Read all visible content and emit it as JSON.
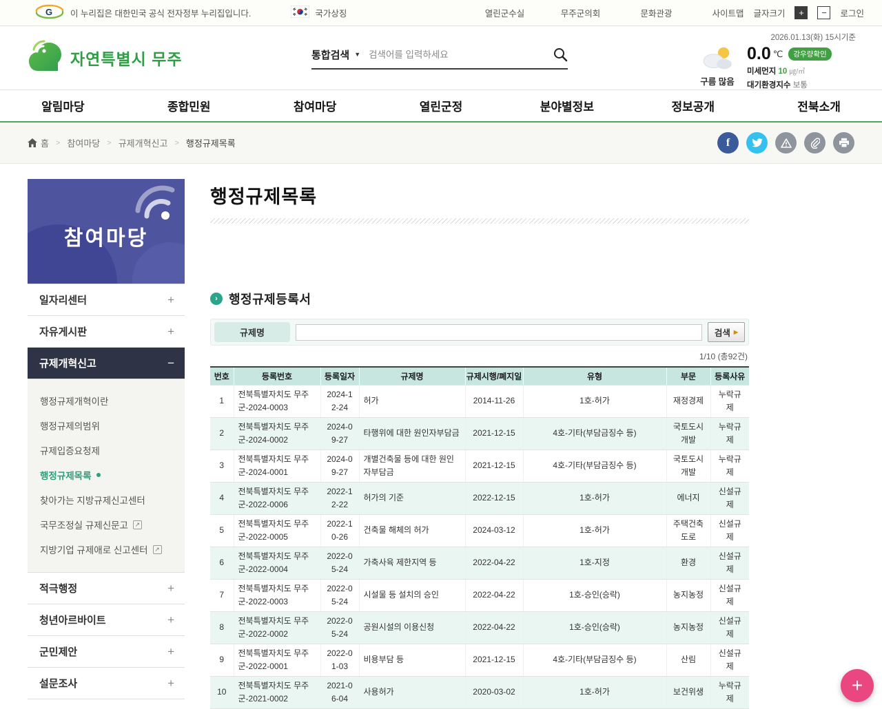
{
  "topbar": {
    "egov_notice": "이 누리집은 대한민국 공식 전자정부 누리집입니다.",
    "national_symbol": "국가상징",
    "links": [
      "열린군수실",
      "무주군의회",
      "문화관광"
    ],
    "sitemap": "사이트맵",
    "font_size_label": "글자크기",
    "font_plus": "+",
    "font_minus": "−",
    "login": "로그인"
  },
  "header": {
    "logo_text": "자연특별시 무주",
    "search": {
      "scope": "통합검색",
      "placeholder": "검색어를 입력하세요"
    },
    "weather": {
      "datetime": "2026.01.13(화) 15시기준",
      "condition": "구름 많음",
      "temperature": "0.0",
      "unit": "℃",
      "rain_badge": "강우량확인",
      "dust_label": "미세먼지",
      "dust_value": "10",
      "dust_unit": "㎍/㎥",
      "air_label": "대기환경지수",
      "air_value": "보통"
    }
  },
  "nav": {
    "items": [
      "알림마당",
      "종합민원",
      "참여마당",
      "열린군정",
      "분야별정보",
      "정보공개",
      "전북소개"
    ]
  },
  "breadcrumb": {
    "home": "홈",
    "items": [
      "참여마당",
      "규제개혁신고",
      "행정규제목록"
    ]
  },
  "sidebar": {
    "title": "참여마당",
    "menu": [
      {
        "label": "일자리센터",
        "toggle": "+"
      },
      {
        "label": "자유게시판",
        "toggle": "+"
      },
      {
        "label": "규제개혁신고",
        "toggle": "−"
      },
      {
        "label": "적극행정",
        "toggle": "+"
      },
      {
        "label": "청년아르바이트",
        "toggle": "+"
      },
      {
        "label": "군민제안",
        "toggle": "+"
      },
      {
        "label": "설문조사",
        "toggle": "+"
      }
    ],
    "submenu": [
      {
        "label": "행정규제개혁이란"
      },
      {
        "label": "행정규제의범위"
      },
      {
        "label": "규제입증요청제"
      },
      {
        "label": "행정규제목록"
      },
      {
        "label": "찾아가는 지방규제신고센터"
      },
      {
        "label": "국무조정실 규제신문고"
      },
      {
        "label": "지방기업 규제애로 신고센터"
      }
    ],
    "external_icon": "↗"
  },
  "main": {
    "page_title": "행정규제목록",
    "section_title": "행정규제등록서",
    "search_label": "규제명",
    "search_button": "검색",
    "count_info": "1/10 (총92건)",
    "table": {
      "headers": [
        "번호",
        "등록번호",
        "등록일자",
        "규제명",
        "규제시행/폐지일",
        "유형",
        "부문",
        "등록사유"
      ],
      "rows": [
        [
          "1",
          "전북특별자치도 무주군-2024-0003",
          "2024-12-24",
          "허가",
          "2014-11-26",
          "1호-허가",
          "재정경제",
          "누락규제"
        ],
        [
          "2",
          "전북특별자치도 무주군-2024-0002",
          "2024-09-27",
          "타행위에 대한 원인자부담금",
          "2021-12-15",
          "4호-기타(부담금징수 등)",
          "국토도시개발",
          "누락규제"
        ],
        [
          "3",
          "전북특별자치도 무주군-2024-0001",
          "2024-09-27",
          "개별건축물 등에 대한 원인자부담금",
          "2021-12-15",
          "4호-기타(부담금징수 등)",
          "국토도시개발",
          "누락규제"
        ],
        [
          "4",
          "전북특별자치도 무주군-2022-0006",
          "2022-12-22",
          "허가의 기준",
          "2022-12-15",
          "1호-허가",
          "에너지",
          "신설규제"
        ],
        [
          "5",
          "전북특별자치도 무주군-2022-0005",
          "2022-10-26",
          "건축물 해체의 허가",
          "2024-03-12",
          "1호-허가",
          "주택건축도로",
          "신설규제"
        ],
        [
          "6",
          "전북특별자치도 무주군-2022-0004",
          "2022-05-24",
          "가축사육 제한지역 등",
          "2022-04-22",
          "1호-지정",
          "환경",
          "신설규제"
        ],
        [
          "7",
          "전북특별자치도 무주군-2022-0003",
          "2022-05-24",
          "시설물 등 설치의 승인",
          "2022-04-22",
          "1호-승인(승락)",
          "농지농정",
          "신설규제"
        ],
        [
          "8",
          "전북특별자치도 무주군-2022-0002",
          "2022-05-24",
          "공원시설의 이용신청",
          "2022-04-22",
          "1호-승인(승락)",
          "농지농정",
          "신설규제"
        ],
        [
          "9",
          "전북특별자치도 무주군-2022-0001",
          "2022-01-03",
          "비용부담 등",
          "2021-12-15",
          "4호-기타(부담금징수 등)",
          "산림",
          "신설규제"
        ],
        [
          "10",
          "전북특별자치도 무주군-2021-0002",
          "2021-06-04",
          "사용허가",
          "2020-03-02",
          "1호-허가",
          "보건위생",
          "누락규제"
        ]
      ]
    }
  },
  "fab": {
    "plus": "+"
  },
  "colors": {
    "accent_green": "#3fa142",
    "nav_underline": "#49a75f",
    "banner_purple": "#4f549f",
    "active_menu": "#2e3346",
    "table_header": "#c6e6df",
    "row_alt": "#e9f6f2",
    "submenu_active": "#2aa17e",
    "fab_pink": "#ea4680"
  }
}
